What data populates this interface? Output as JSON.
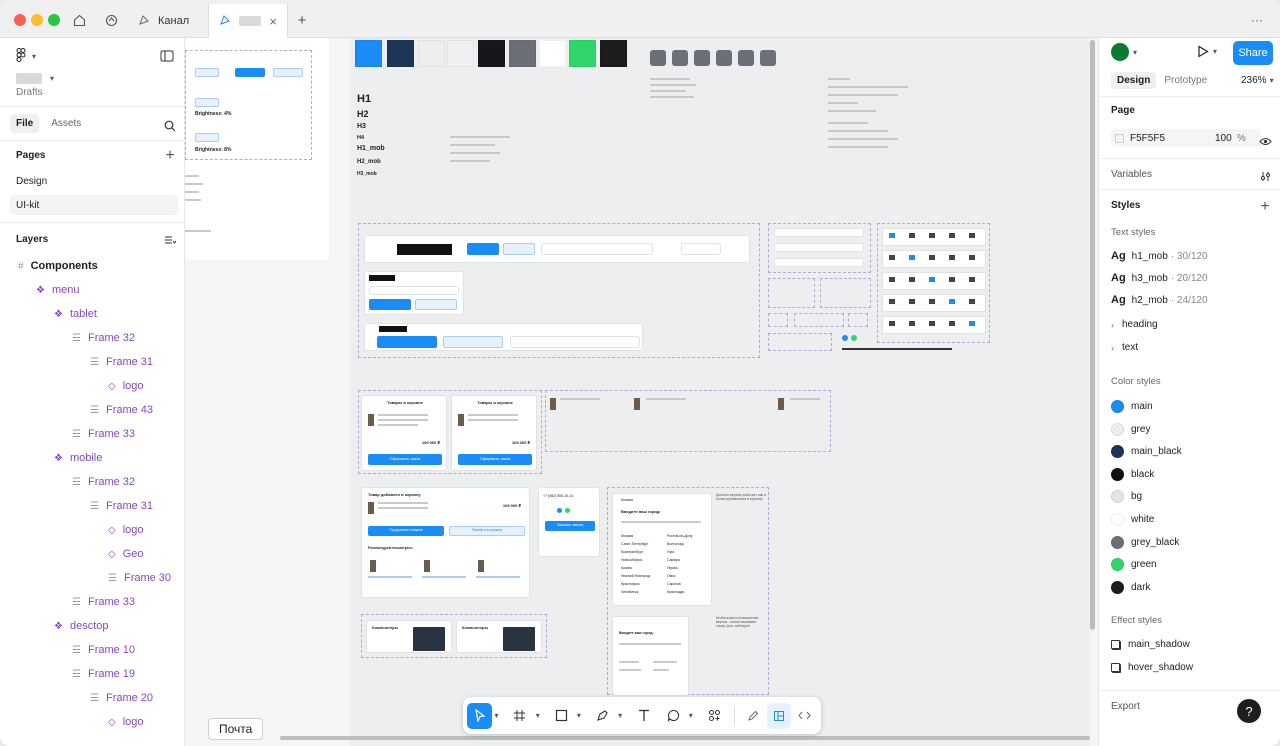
{
  "app": {
    "tabs": [
      {
        "label": "Канал"
      },
      {
        "label": ""
      }
    ],
    "more_label": "···"
  },
  "left_panel": {
    "workspace": "Drafts",
    "file_tab": "File",
    "assets_tab": "Assets",
    "pages_title": "Pages",
    "pages": [
      "Design",
      "UI-kit"
    ],
    "layers_title": "Layers",
    "layers": [
      {
        "label": "Components",
        "kind": "frame"
      },
      {
        "label": "menu",
        "kind": "component"
      },
      {
        "label": "tablet",
        "kind": "component"
      },
      {
        "label": "Frame 32",
        "kind": "frame"
      },
      {
        "label": "Frame 31",
        "kind": "frame"
      },
      {
        "label": "logo",
        "kind": "instance"
      },
      {
        "label": "Frame 43",
        "kind": "frame"
      },
      {
        "label": "Frame 33",
        "kind": "frame"
      },
      {
        "label": "mobile",
        "kind": "component"
      },
      {
        "label": "Frame 32",
        "kind": "frame"
      },
      {
        "label": "Frame 31",
        "kind": "frame"
      },
      {
        "label": "logo",
        "kind": "instance"
      },
      {
        "label": "Geo",
        "kind": "instance"
      },
      {
        "label": "Frame 30",
        "kind": "frame"
      },
      {
        "label": "Frame 33",
        "kind": "frame"
      },
      {
        "label": "desctop",
        "kind": "component"
      },
      {
        "label": "Frame 10",
        "kind": "frame"
      },
      {
        "label": "Frame 19",
        "kind": "frame"
      },
      {
        "label": "Frame 20",
        "kind": "frame"
      },
      {
        "label": "logo",
        "kind": "instance"
      }
    ]
  },
  "right_panel": {
    "share_label": "Share",
    "design_tab": "Design",
    "prototype_tab": "Prototype",
    "zoom": "236%",
    "page_title": "Page",
    "page_color": "F5F5F5",
    "page_opacity": "100",
    "page_opacity_unit": "%",
    "variables_title": "Variables",
    "styles_title": "Styles",
    "text_styles_title": "Text styles",
    "text_styles": [
      {
        "name": "h1_mob",
        "spec": "· 30/120"
      },
      {
        "name": "h3_mob",
        "spec": "· 20/120"
      },
      {
        "name": "h2_mob",
        "spec": "· 24/120"
      }
    ],
    "text_groups": [
      "heading",
      "text"
    ],
    "color_styles_title": "Color styles",
    "color_styles": [
      {
        "name": "main",
        "color": "#1a8cf5"
      },
      {
        "name": "grey",
        "color": "#eeeeee"
      },
      {
        "name": "main_black",
        "color": "#1d3557"
      },
      {
        "name": "black",
        "color": "#111111"
      },
      {
        "name": "bg",
        "color": "#e4e4e4"
      },
      {
        "name": "white",
        "color": "#ffffff"
      },
      {
        "name": "grey_black",
        "color": "#6b7078"
      },
      {
        "name": "green",
        "color": "#2fd66a"
      },
      {
        "name": "dark",
        "color": "#1c1c1c"
      }
    ],
    "effect_styles_title": "Effect styles",
    "effect_styles": [
      "main_shadow",
      "hover_shadow"
    ],
    "export_title": "Export",
    "help_label": "?"
  },
  "canvas": {
    "palette": [
      "#1a8cf5",
      "#1d3557",
      "#eeeeee",
      "#eef0f2",
      "#15171c",
      "#6b7078",
      "#ffffff",
      "#2fd66a",
      "#1c1c1c"
    ],
    "grey_squares": 6,
    "headings": [
      "H1",
      "H2",
      "H3",
      "H4",
      "H1_mob",
      "H2_mob",
      "H3_mob"
    ],
    "left_partial_texts": [
      "Brightness: 4%",
      "Brightness: 8%"
    ],
    "cart_title_1": "Товары в корзине",
    "cart_title_2": "Товары в корзине",
    "cart_button": "Оформить заказ",
    "cart_price": "169 000 ₽",
    "added_title": "Товар добавлен в корзину",
    "continue_btn": "Продолжить покупки",
    "go_cart_btn": "Перейти в корзину",
    "recommend": "Рекомендуем посмотреть",
    "city_title": "Введите ваш город:",
    "city_place": "Москва",
    "cities_left": [
      "Москва",
      "Санкт-Петербург",
      "Екатеринбург",
      "Новосибирск",
      "Казань",
      "Нижний Новгород",
      "Красноярск",
      "Челябинск"
    ],
    "cities_right": [
      "Ростов-на-Дону",
      "Волгоград",
      "Уфа",
      "Самара",
      "Пермь",
      "Омск",
      "Саратов",
      "Краснодар"
    ],
    "phone": "+7 (982) 555-15-14",
    "callback_btn": "Заказать звонок",
    "catalog_label": "Каталог",
    "sale_label": "Скупка",
    "cart_label": "Корзина",
    "computers": [
      "Компьютеры",
      "Компьютеры"
    ],
    "side_notes": [
      "Десктоп версия работает как и попап добавления в корзину",
      "Мобильная и планшетная версия - попап вызывает снизу, фон заблюрен"
    ]
  },
  "toolbar": {
    "tooltip": "Почта"
  }
}
